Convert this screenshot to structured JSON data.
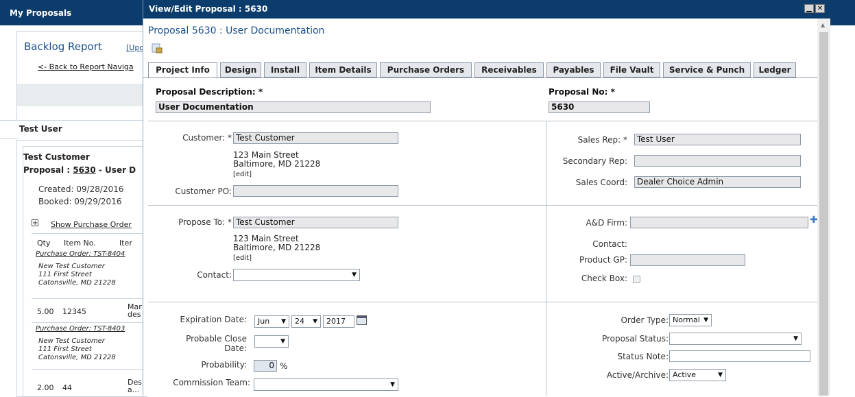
{
  "background": {
    "title": "My Proposals",
    "report_title": "Backlog Report",
    "report_link": "[Upo",
    "back_link": "<- Back to Report Naviga",
    "user_name": "Test User",
    "customer": "Test Customer",
    "proposal_line_prefix": "Proposal : ",
    "proposal_number": "5630",
    "proposal_line_suffix": " - User D",
    "created": "Created: 09/28/2016",
    "booked": "Booked: 09/29/2016",
    "show_po_label": "Show Purchase Order",
    "col_qty": "Qty",
    "col_item": "Item No.",
    "col_item2": "Iter",
    "po1": "Purchase Order: TST-8404",
    "po1_addr": [
      "New Test Customer",
      "111 First Street",
      "Catonsville, MD 21228"
    ],
    "row1": {
      "qty": "5.00",
      "item": "12345",
      "desc1": "Mar",
      "desc2": "des"
    },
    "po2": "Purchase Order: TST-8403",
    "po2_addr": [
      "New Test Customer",
      "111 First Street",
      "Catonsville, MD 21228"
    ],
    "row2": {
      "qty": "2.00",
      "item": "44",
      "desc1": "Des",
      "desc2": "a..."
    }
  },
  "modal": {
    "title": "View/Edit Proposal : 5630",
    "minimize": "▁",
    "close": "✕",
    "header": "Proposal 5630 : User Documentation",
    "tabs": [
      "Project Info",
      "Design",
      "Install",
      "Item Details",
      "Purchase Orders",
      "Receivables",
      "Payables",
      "File Vault",
      "Service & Punch",
      "Ledger"
    ],
    "proposal_description_label": "Proposal Description: *",
    "proposal_description": "User Documentation",
    "proposal_no_label": "Proposal No: *",
    "proposal_no": "5630",
    "customer_label": "Customer: *",
    "customer": "Test Customer",
    "customer_addr1": "123 Main Street",
    "customer_addr2": "Baltimore,  MD 21228",
    "edit_link": "[edit]",
    "customer_po_label": "Customer PO:",
    "customer_po": "",
    "sales_rep_label": "Sales Rep: *",
    "sales_rep": "Test User",
    "secondary_rep_label": "Secondary Rep:",
    "secondary_rep": "",
    "sales_coord_label": "Sales Coord:",
    "sales_coord": "Dealer Choice Admin",
    "propose_to_label": "Propose To: *",
    "propose_to": "Test Customer",
    "propose_addr1": "123 Main Street",
    "propose_addr2": "Baltimore,  MD 21228",
    "contact_label": "Contact:",
    "contact_value": "",
    "ad_firm_label": "A&D Firm:",
    "ad_contact_label": "Contact:",
    "product_gp_label": "Product GP:",
    "check_box_label": "Check Box:",
    "expiration_label": "Expiration Date:",
    "exp_month": "Jun",
    "exp_day": "24",
    "exp_year": "2017",
    "probable_close_label_1": "Probable Close",
    "probable_close_label_2": "Date:",
    "probability_label": "Probability:",
    "probability_value": "0",
    "probability_unit": "%",
    "commission_team_label": "Commission Team:",
    "order_type_label": "Order Type:",
    "order_type": "Normal",
    "proposal_status_label": "Proposal Status:",
    "status_note_label": "Status Note:",
    "active_archive_label": "Active/Archive:",
    "active_archive": "Active"
  }
}
